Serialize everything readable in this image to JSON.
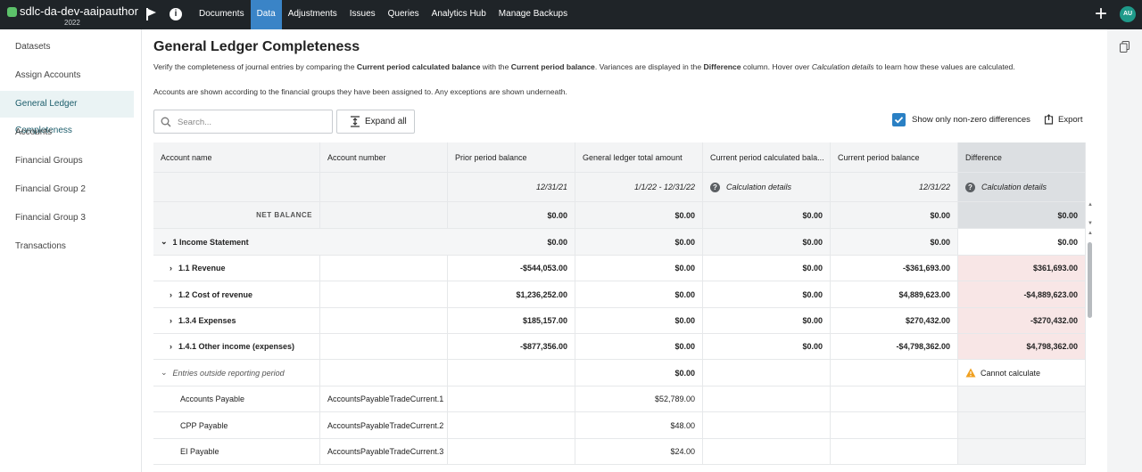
{
  "app": {
    "name": "sdlc-da-dev-aaipauthor",
    "year": "2022",
    "avatar_initials": "AU"
  },
  "nav": {
    "items": [
      {
        "label": "Documents",
        "active": false
      },
      {
        "label": "Data",
        "active": true
      },
      {
        "label": "Adjustments",
        "active": false
      },
      {
        "label": "Issues",
        "active": false
      },
      {
        "label": "Queries",
        "active": false
      },
      {
        "label": "Analytics Hub",
        "active": false
      },
      {
        "label": "Manage Backups",
        "active": false
      }
    ]
  },
  "sidebar": {
    "items": [
      {
        "label": "Datasets"
      },
      {
        "label": "Assign Accounts"
      },
      {
        "label": "General Ledger Completeness",
        "active": true
      },
      {
        "label": "Accounts"
      },
      {
        "label": "Financial Groups"
      },
      {
        "label": "Financial Group 2"
      },
      {
        "label": "Financial Group 3"
      },
      {
        "label": "Transactions"
      }
    ]
  },
  "page": {
    "title": "General Ledger Completeness",
    "desc_part1": "Verify the completeness of journal entries by comparing the ",
    "desc_bold1": "Current period calculated balance",
    "desc_part2": " with the ",
    "desc_bold2": "Current period balance",
    "desc_part3": ". Variances are displayed in the ",
    "desc_bold3": "Difference",
    "desc_part4": " column. Hover over ",
    "desc_ital": "Calculation details",
    "desc_part5": " to learn how these values are calculated.",
    "desc2": "Accounts are shown according to the financial groups they have been assigned to. Any exceptions are shown underneath."
  },
  "toolbar": {
    "search_placeholder": "Search...",
    "expand_label": "Expand all",
    "show_nonzero_label": "Show only non-zero differences",
    "show_nonzero_checked": true,
    "export_label": "Export"
  },
  "table": {
    "headers": [
      "Account name",
      "Account number",
      "Prior period balance",
      "General ledger total amount",
      "Current period calculated bala...",
      "Current period balance",
      "Difference"
    ],
    "subheaders": {
      "prior": "12/31/21",
      "gl": "1/1/22 - 12/31/22",
      "calc": "Calculation details",
      "current": "12/31/22",
      "diff": "Calculation details"
    },
    "net": {
      "label": "NET BALANCE",
      "prior": "$0.00",
      "gl": "$0.00",
      "calc": "$0.00",
      "current": "$0.00",
      "diff": "$0.00"
    },
    "income": {
      "label": "1 Income Statement",
      "prior": "$0.00",
      "gl": "$0.00",
      "calc": "$0.00",
      "current": "$0.00",
      "diff": "$0.00"
    },
    "groups": [
      {
        "label": "1.1 Revenue",
        "prior": "-$544,053.00",
        "gl": "$0.00",
        "calc": "$0.00",
        "current": "-$361,693.00",
        "diff": "$361,693.00"
      },
      {
        "label": "1.2 Cost of revenue",
        "prior": "$1,236,252.00",
        "gl": "$0.00",
        "calc": "$0.00",
        "current": "$4,889,623.00",
        "diff": "-$4,889,623.00"
      },
      {
        "label": "1.3.4 Expenses",
        "prior": "$185,157.00",
        "gl": "$0.00",
        "calc": "$0.00",
        "current": "$270,432.00",
        "diff": "-$270,432.00"
      },
      {
        "label": "1.4.1 Other income (expenses)",
        "prior": "-$877,356.00",
        "gl": "$0.00",
        "calc": "$0.00",
        "current": "-$4,798,362.00",
        "diff": "$4,798,362.00"
      }
    ],
    "outside": {
      "label": "Entries outside reporting period",
      "gl": "$0.00",
      "diff": "Cannot calculate"
    },
    "entries": [
      {
        "name": "Accounts Payable",
        "number": "AccountsPayableTradeCurrent.1",
        "gl": "$52,789.00"
      },
      {
        "name": "CPP Payable",
        "number": "AccountsPayableTradeCurrent.2",
        "gl": "$48.00"
      },
      {
        "name": "EI Payable",
        "number": "AccountsPayableTradeCurrent.3",
        "gl": "$24.00"
      }
    ]
  }
}
